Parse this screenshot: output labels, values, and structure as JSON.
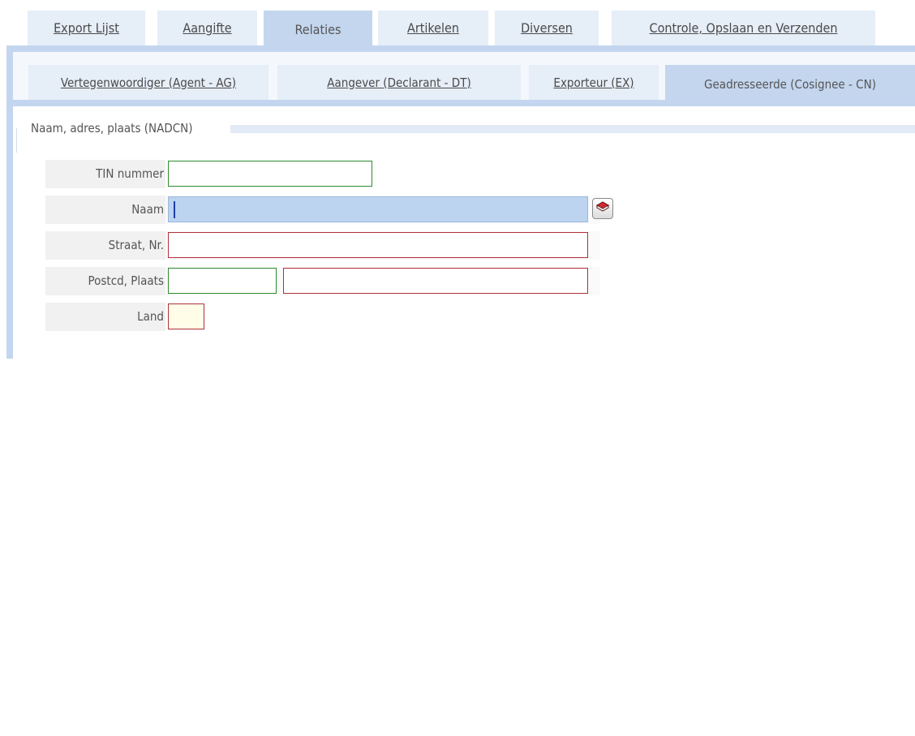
{
  "top_tabs": [
    {
      "label": "Export Lijst",
      "active": false
    },
    {
      "label": "Aangifte",
      "active": false
    },
    {
      "label": "Relaties",
      "active": true
    },
    {
      "label": "Artikelen",
      "active": false
    },
    {
      "label": "Diversen",
      "active": false
    },
    {
      "label": "Controle, Opslaan en Verzenden",
      "active": false
    }
  ],
  "sub_tabs": [
    {
      "label": "Vertegenwoordiger (Agent - AG)",
      "active": false
    },
    {
      "label": "Aangever (Declarant - DT)",
      "active": false
    },
    {
      "label": "Exporteur (EX)",
      "active": false
    },
    {
      "label": "Geadresseerde (Cosignee - CN)",
      "active": true
    }
  ],
  "section": {
    "legend": "Naam, adres, plaats (NADCN)"
  },
  "form": {
    "tin_label": "TIN nummer",
    "tin_value": "",
    "naam_label": "Naam",
    "naam_value": "",
    "straat_label": "Straat, Nr.",
    "straat_value": "",
    "postcd_label": "Postcd, Plaats",
    "postcd_value": "",
    "plaats_value": "",
    "land_label": "Land",
    "land_value": ""
  },
  "icons": {
    "lookup": "address-book-icon"
  },
  "colors": {
    "tab_inactive": "#e6eef8",
    "tab_active": "#c3d6ee",
    "frame": "#c4d6ef",
    "optional_border": "#2e8b2e",
    "required_border": "#b0303a",
    "focused_field": "#bcd4ef",
    "lookup_book": "#c0202a"
  }
}
